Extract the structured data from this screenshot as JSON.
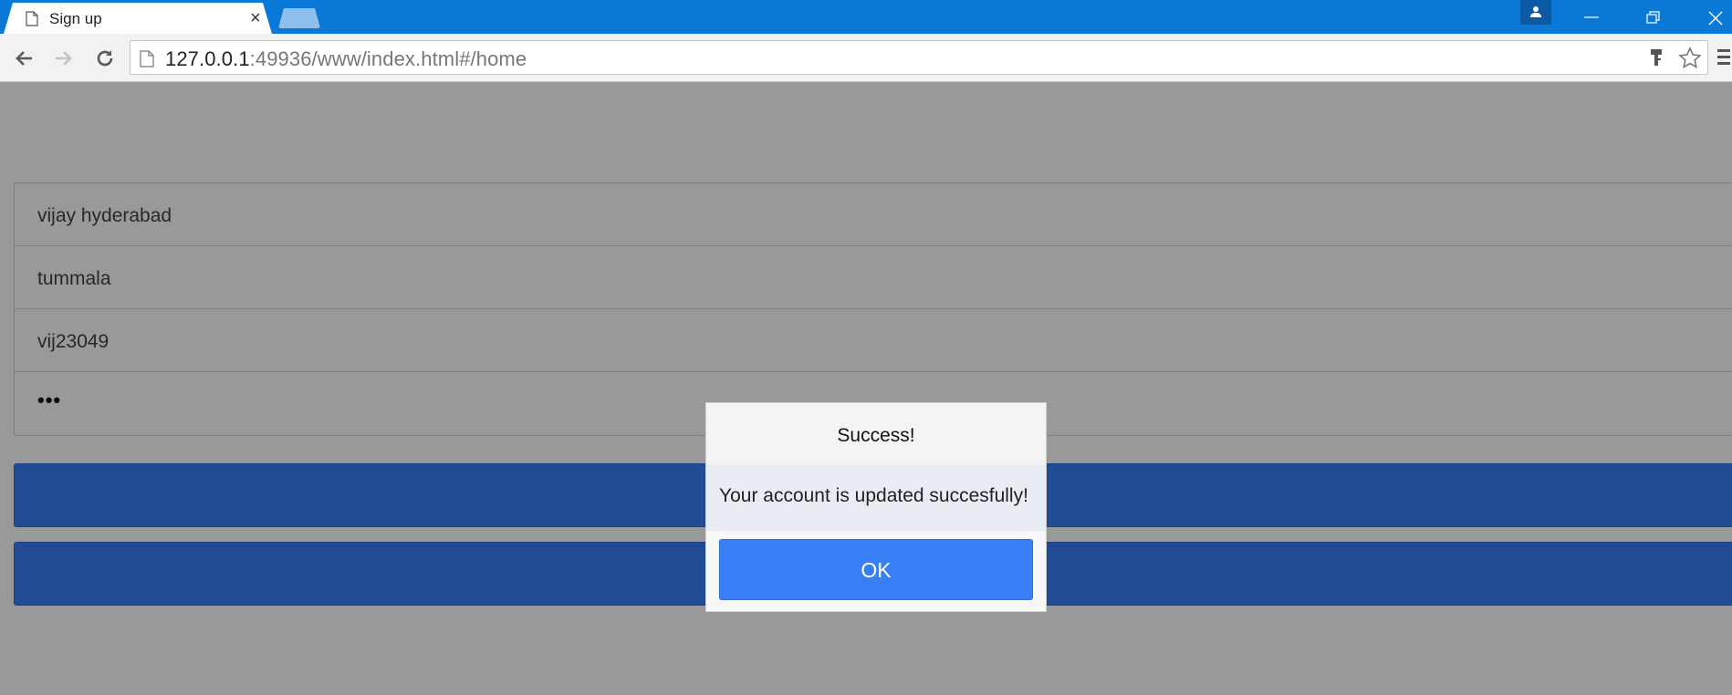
{
  "browser": {
    "tab_title": "Sign up",
    "tab_close": "×",
    "url_host": "127.0.0.1",
    "url_rest": ":49936/www/index.html#/home"
  },
  "form": {
    "fields": [
      {
        "value": "vijay hyderabad"
      },
      {
        "value": "tummala"
      },
      {
        "value": "vij23049"
      },
      {
        "value": "•••"
      }
    ]
  },
  "alert": {
    "title": "Success!",
    "message": "Your account is updated succesfully!",
    "ok_label": "OK"
  },
  "colors": {
    "titlebar": "#0a78d7",
    "primary": "#387ef5"
  }
}
